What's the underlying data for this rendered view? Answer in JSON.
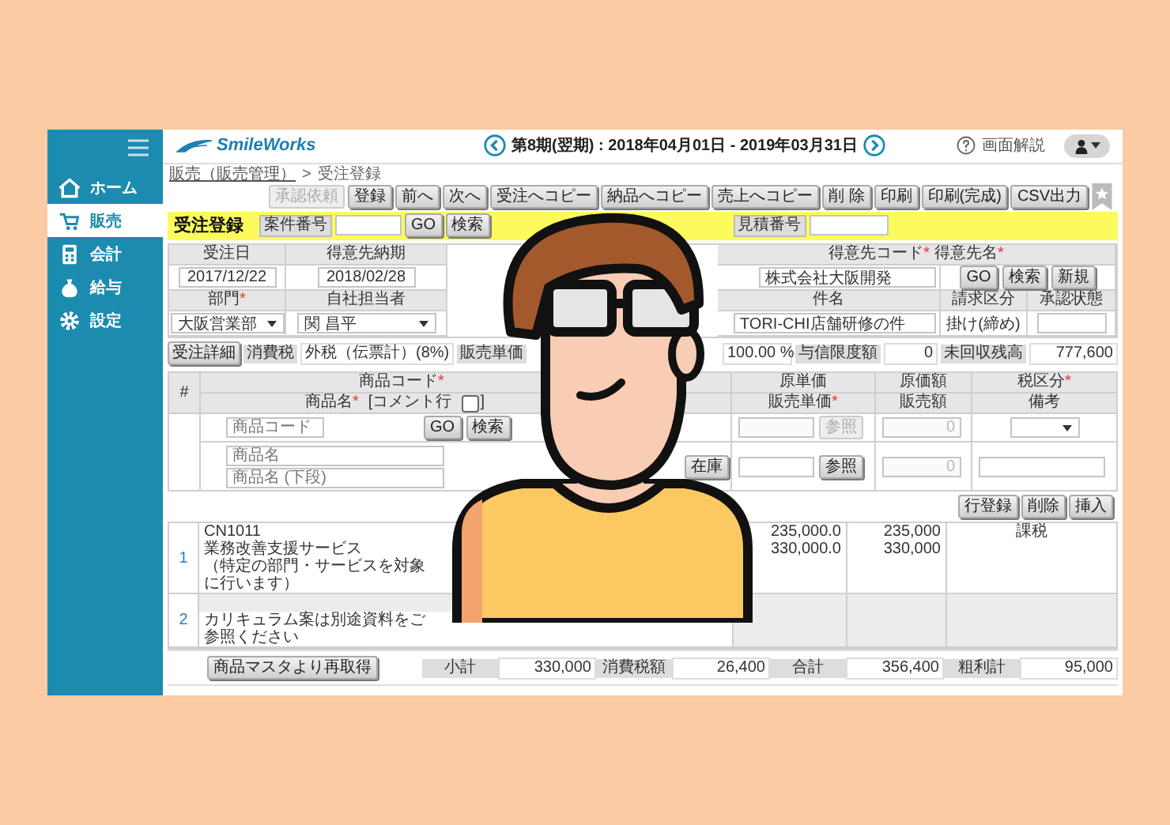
{
  "sidebar": {
    "items": [
      {
        "label": "ホーム",
        "selected": false
      },
      {
        "label": "販売",
        "selected": true
      },
      {
        "label": "会計",
        "selected": false
      },
      {
        "label": "給与",
        "selected": false
      },
      {
        "label": "設定",
        "selected": false
      }
    ]
  },
  "header": {
    "logo": "SmileWorks",
    "period": "第8期(翌期) : 2018年04月01日 - 2019年03月31日",
    "help": "画面解説"
  },
  "required_mark": "*",
  "breadcrumb": {
    "parent": "販売（販売管理）",
    "separator": ">",
    "current": "受注登録"
  },
  "toolbar": [
    {
      "label": "承認依頼",
      "disabled": true
    },
    {
      "label": "登録",
      "disabled": false
    },
    {
      "label": "前へ",
      "disabled": false
    },
    {
      "label": "次へ",
      "disabled": false
    },
    {
      "label": "受注へコピー",
      "disabled": false
    },
    {
      "label": "納品へコピー",
      "disabled": false
    },
    {
      "label": "売上へコピー",
      "disabled": false
    },
    {
      "label": "削 除",
      "disabled": false
    },
    {
      "label": "印刷",
      "disabled": false
    },
    {
      "label": "印刷(完成)",
      "disabled": false
    },
    {
      "label": "CSV出力",
      "disabled": false
    }
  ],
  "title_bar": {
    "title": "受注登録",
    "project_label": "案件番号",
    "buttons": [
      "GO",
      "検索"
    ],
    "estimate_label": "見積番号"
  },
  "order_header": {
    "order_date": {
      "label": "受注日",
      "value": "2017/12/22"
    },
    "due_date": {
      "label": "得意先納期",
      "value": "2018/02/28"
    },
    "customer": {
      "labels": [
        {
          "text": "得意先コード",
          "required": true
        },
        {
          "text": "得意先名",
          "required": true
        }
      ],
      "name": "株式会社大阪開発",
      "buttons": [
        "GO",
        "検索",
        "新規"
      ]
    },
    "department": {
      "label": "部門",
      "required": true,
      "value": "大阪営業部"
    },
    "staff": {
      "label": "自社担当者",
      "required": false,
      "value": "関 昌平"
    },
    "subject": {
      "label": "件名",
      "value": "TORI-CHI店舗研修の件"
    },
    "billing": {
      "label": "請求区分",
      "value": "掛け(締め)"
    },
    "approval": {
      "label": "承認状態"
    }
  },
  "summary": {
    "detail_button": "受注詳細",
    "tax_label": "消費税",
    "tax_value": "外税（伝票計）(8%)",
    "price_label": "販売単価",
    "rate": "100.00 %",
    "credit_label": "与信限度額",
    "credit_value": "0",
    "balance_label": "未回収残高",
    "balance_value": "777,600"
  },
  "entry": {
    "hash": "#",
    "code_label": {
      "text": "商品コード",
      "required": true
    },
    "name_label": {
      "text": "商品名",
      "required": true
    },
    "comment_open": "[コメント行",
    "comment_checked": false,
    "comment_close": "]",
    "columns": [
      {
        "top": {
          "text": "原単価",
          "required": false
        },
        "bottom": {
          "text": "販売単価",
          "required": true
        }
      },
      {
        "top": {
          "text": "原価額",
          "required": false
        },
        "bottom": {
          "text": "販売額",
          "required": false
        }
      },
      {
        "top": {
          "text": "税区分",
          "required": true
        },
        "bottom": {
          "text": "備考",
          "required": false
        }
      }
    ],
    "code_placeholder": "商品コード",
    "code_buttons": [
      "GO",
      "検索"
    ],
    "name_placeholder": "商品名",
    "name2_placeholder": "商品名 (下段)",
    "stock_button": "在庫",
    "ref_buttons": [
      {
        "label": "参照",
        "disabled": true
      },
      {
        "label": "参照",
        "disabled": false
      }
    ],
    "amounts": [
      "0",
      "0"
    ]
  },
  "row_buttons": [
    "行登録",
    "削除",
    "挿入"
  ],
  "lines": [
    {
      "kind": "item",
      "no": "1",
      "code": "CN1011",
      "name": "業務改善支援サービス",
      "note": "（特定の部門・サービスを対象に行います）",
      "unit_cost": "235,000.0",
      "unit_price": "330,000.0",
      "cost": "235,000",
      "amount": "330,000",
      "tax": "課税"
    },
    {
      "kind": "comment",
      "no": "2",
      "text": "カリキュラム案は別途資料をご参照ください"
    }
  ],
  "footer": {
    "button": "商品マスタより再取得",
    "totals": [
      {
        "label": "小計",
        "value": "330,000"
      },
      {
        "label": "消費税額",
        "value": "26,400"
      },
      {
        "label": "合計",
        "value": "356,400"
      },
      {
        "label": "粗利計",
        "value": "95,000"
      }
    ]
  }
}
